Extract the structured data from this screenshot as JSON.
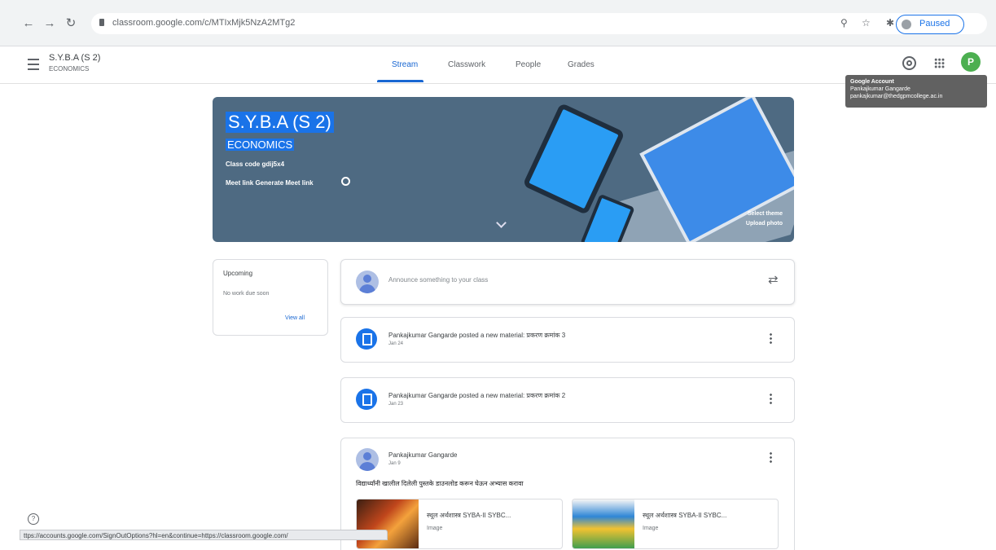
{
  "browser": {
    "url": "classroom.google.com/c/MTIxMjk5NzA2MTg2",
    "paused_label": "Paused"
  },
  "header": {
    "class_title": "S.Y.B.A (S 2)",
    "class_subtitle": "ECONOMICS",
    "tabs": [
      {
        "label": "Stream"
      },
      {
        "label": "Classwork"
      },
      {
        "label": "People"
      },
      {
        "label": "Grades"
      }
    ],
    "avatar_letter": "P"
  },
  "tooltip": {
    "title": "Google Account",
    "name": "Pankajkumar Gangarde",
    "email": "pankajkumar@thedgpmcollege.ac.in"
  },
  "banner": {
    "title": "S.Y.B.A (S 2)",
    "subject": "ECONOMICS",
    "class_code": "Class code  gdij5x4",
    "meet_link": "Meet link  Generate Meet link",
    "select_theme": "Select theme",
    "upload_photo": "Upload photo"
  },
  "upcoming": {
    "title": "Upcoming",
    "body": "No work due soon",
    "view_all": "View all"
  },
  "announce": {
    "placeholder": "Announce something to your class"
  },
  "posts": [
    {
      "text": "Pankajkumar Gangarde posted a new material: प्रकरण क्रमांक 3",
      "date": "Jan 24"
    },
    {
      "text": "Pankajkumar Gangarde posted a new material: प्रकरण क्रमांक 2",
      "date": "Jan 23"
    }
  ],
  "post3": {
    "author": "Pankajkumar Gangarde",
    "date": "Jan 9",
    "body": "विद्यार्थ्यांनी खालील दिलेली पुस्तके डाउनलोड करून घेऊन अभ्यास करावा",
    "attachments": [
      {
        "title": "स्थूल अर्थशास्त्र SYBA-II SYBC...",
        "type": "Image"
      },
      {
        "title": "स्थूल अर्थशास्त्र SYBA-II SYBC...",
        "type": "Image"
      }
    ]
  },
  "status_bar": {
    "text": "ttps://accounts.google.com/SignOutOptions?hl=en&continue=https://classroom.google.com/"
  },
  "colors": {
    "accent": "#1967d2",
    "banner": "#4e6a82",
    "avatar": "#4caf50"
  }
}
